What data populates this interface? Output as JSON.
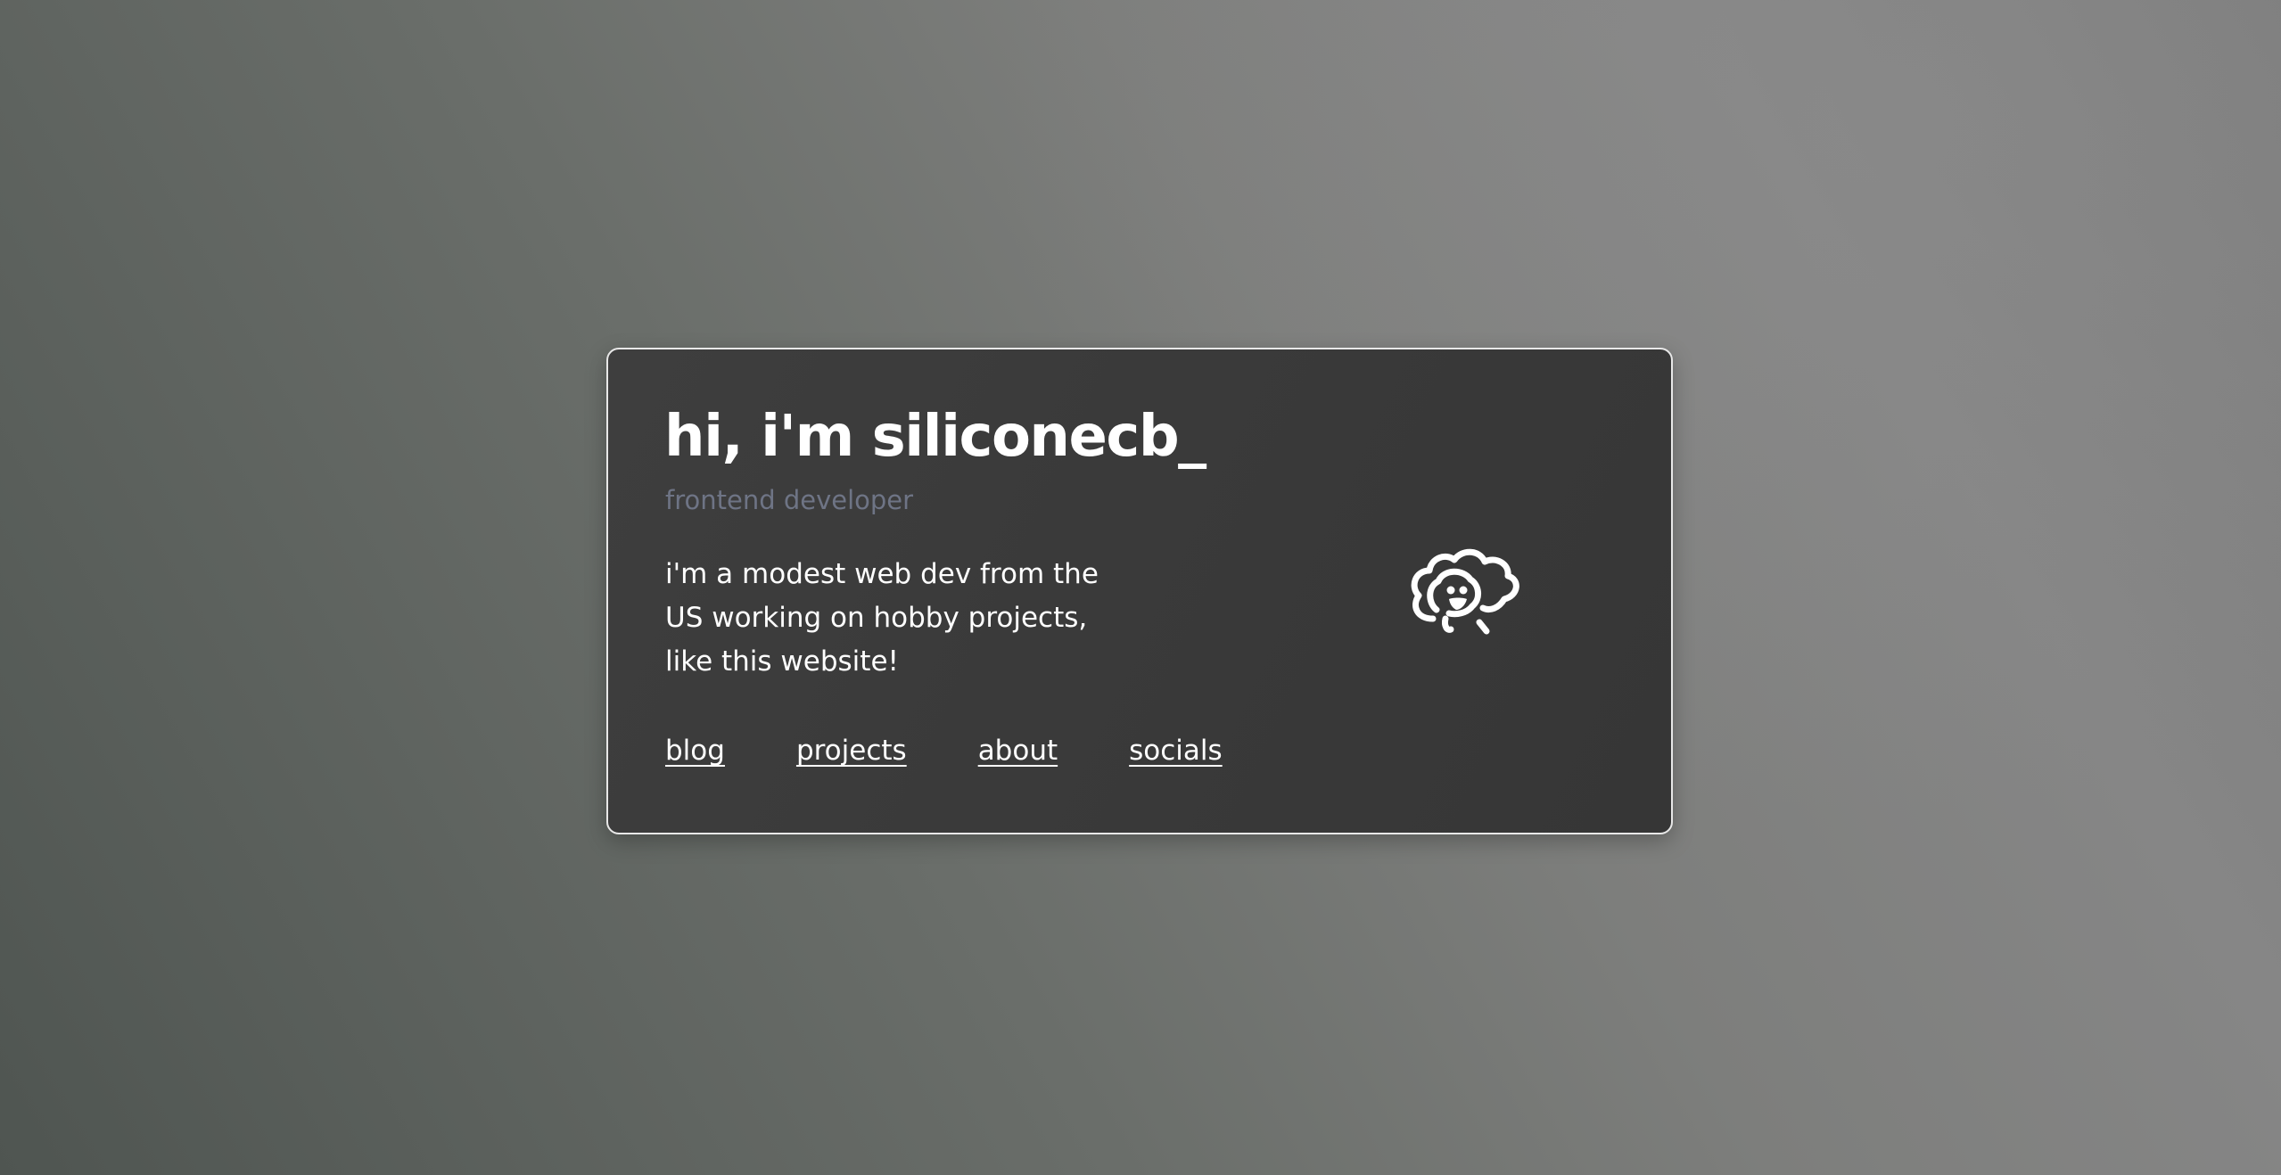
{
  "card": {
    "title": "hi, i'm siliconecb_",
    "subtitle": "frontend developer",
    "bio": "i'm a modest web dev from the US working on hobby projects, like this website!",
    "nav": [
      {
        "label": "blog"
      },
      {
        "label": "projects"
      },
      {
        "label": "about"
      },
      {
        "label": "socials"
      }
    ],
    "mascot_icon": "doodle-cloud-mascot-icon"
  },
  "colors": {
    "card_background": "#3b3b3b",
    "subtitle": "#6e7485",
    "text": "#ffffff"
  }
}
